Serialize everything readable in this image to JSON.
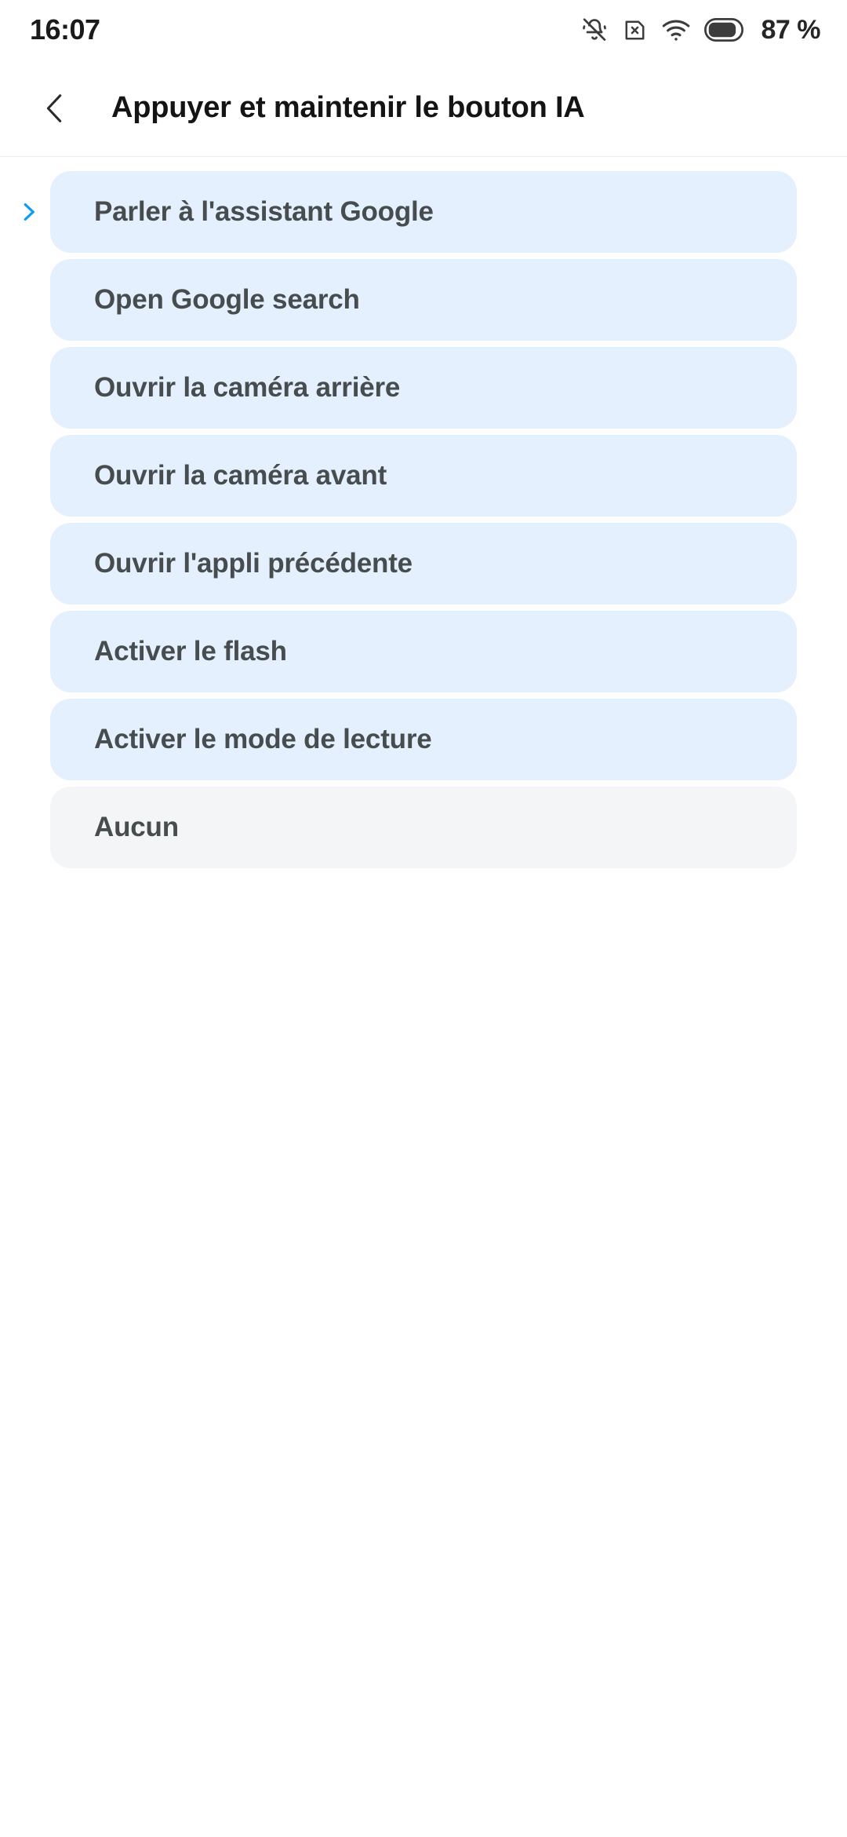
{
  "status_bar": {
    "time": "16:07",
    "battery_percent": "87 %",
    "icons": [
      {
        "name": "bell-muted-icon"
      },
      {
        "name": "sim-card-missing-icon"
      },
      {
        "name": "wifi-icon"
      },
      {
        "name": "battery-icon"
      }
    ]
  },
  "header": {
    "back_label": "",
    "title": "Appuyer et maintenir le bouton IA"
  },
  "options": [
    {
      "label": "Parler à l'assistant Google",
      "style": "blue",
      "marked": true
    },
    {
      "label": "Open Google search",
      "style": "blue",
      "marked": false
    },
    {
      "label": "Ouvrir la caméra arrière",
      "style": "blue",
      "marked": false
    },
    {
      "label": "Ouvrir la caméra avant",
      "style": "blue",
      "marked": false
    },
    {
      "label": "Ouvrir l'appli précédente",
      "style": "blue",
      "marked": false
    },
    {
      "label": "Activer le flash",
      "style": "blue",
      "marked": false
    },
    {
      "label": "Activer le mode de lecture",
      "style": "blue",
      "marked": false
    },
    {
      "label": "Aucun",
      "style": "grey",
      "marked": false
    }
  ],
  "colors": {
    "card_blue": "#e4f0fd",
    "card_grey": "#f4f5f6",
    "marker_blue": "#0d9cf5",
    "label_text": "#474c4f",
    "title_text": "#141414",
    "page_background": "#ffffff"
  }
}
